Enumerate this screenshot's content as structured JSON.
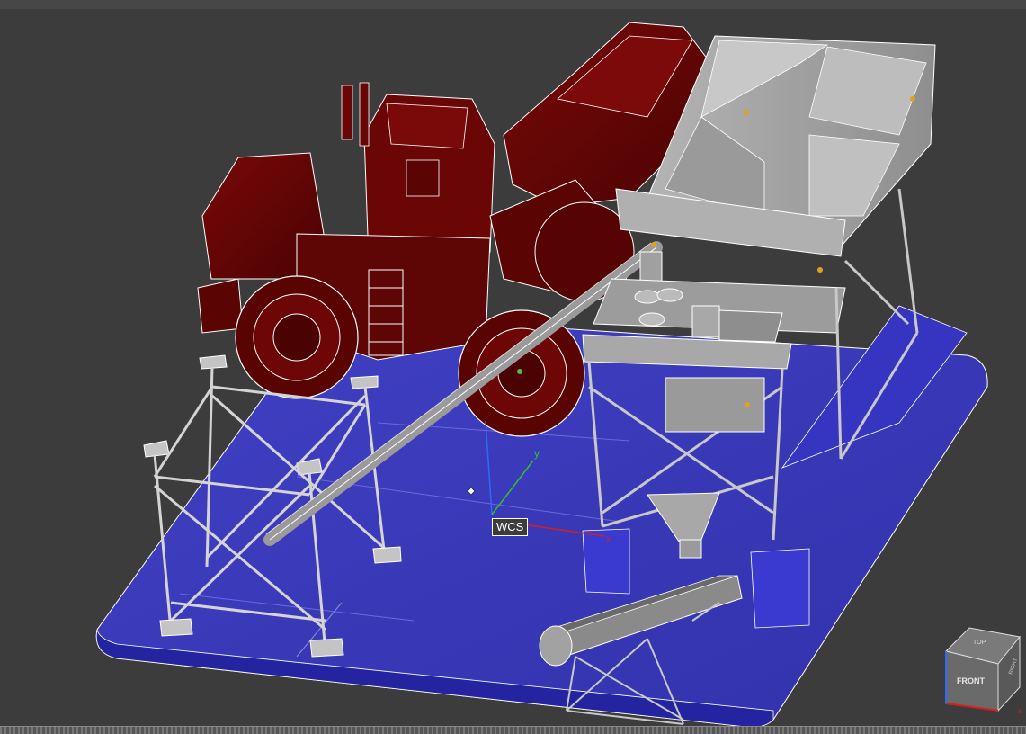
{
  "viewport": {
    "background": "#3c3c3c",
    "colors": {
      "ground": "#3a3ab8",
      "ground_edge": "#2222a0",
      "loader": "#6b0505",
      "frame": "#b8b8b8",
      "hopper": "#a4a4a4",
      "wire": "#ffffff"
    }
  },
  "wcs": {
    "label": "WCS",
    "axes": {
      "x_color": "#d02020",
      "y_color": "#30c030",
      "z_color": "#2a6cff"
    },
    "y_label": "y",
    "x_label": "x"
  },
  "viewcube": {
    "top_label": "TOP",
    "front_label": "FRONT",
    "right_label": "RIGHT",
    "icon": "navigation-cube-icon"
  }
}
